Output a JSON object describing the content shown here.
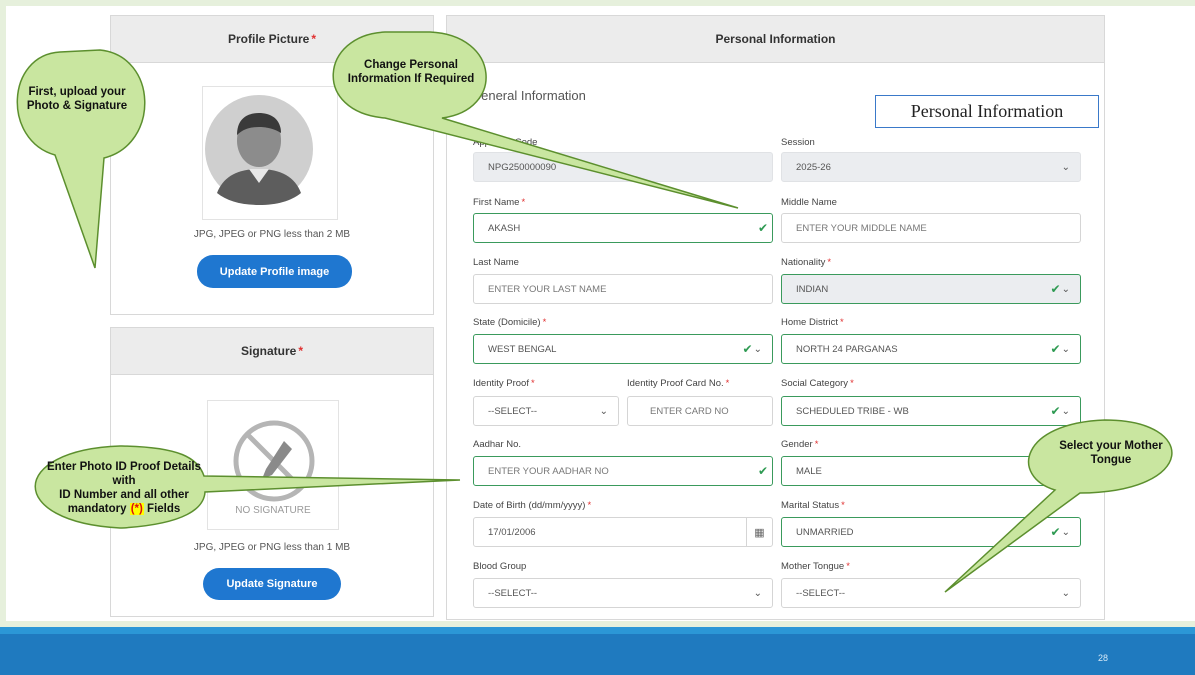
{
  "profile": {
    "title": "Profile Picture",
    "required_mark": "*",
    "hint": "JPG, JPEG or PNG less than 2 MB",
    "button": "Update Profile image"
  },
  "signature": {
    "title": "Signature",
    "required_mark": "*",
    "placeholder_text": "NO SIGNATURE",
    "hint": "JPG, JPEG or PNG less than 1 MB",
    "button": "Update Signature"
  },
  "form": {
    "title": "Personal Information",
    "section": "General Information",
    "overlay_label": "Personal Information",
    "fields": {
      "applicant_code": {
        "label": "Applicant Code",
        "value": "NPG250000090"
      },
      "session": {
        "label": "Session",
        "value": "2025-26"
      },
      "first_name": {
        "label": "First Name",
        "req": "*",
        "value": "AKASH"
      },
      "middle_name": {
        "label": "Middle Name",
        "placeholder": "ENTER YOUR MIDDLE NAME"
      },
      "last_name": {
        "label": "Last Name",
        "placeholder": "ENTER YOUR LAST NAME"
      },
      "nationality": {
        "label": "Nationality",
        "req": "*",
        "value": "INDIAN"
      },
      "state": {
        "label": "State (Domicile)",
        "req": "*",
        "value": "WEST BENGAL"
      },
      "home_district": {
        "label": "Home District",
        "req": "*",
        "value": "NORTH 24 PARGANAS"
      },
      "identity_proof": {
        "label": "Identity Proof",
        "req": "*",
        "value": "--SELECT--"
      },
      "identity_card_no": {
        "label": "Identity Proof Card No.",
        "req": "*",
        "placeholder": "ENTER CARD NO"
      },
      "social_category": {
        "label": "Social Category",
        "req": "*",
        "value": "SCHEDULED TRIBE - WB"
      },
      "aadhar": {
        "label": "Aadhar No.",
        "placeholder": "ENTER YOUR AADHAR NO"
      },
      "gender": {
        "label": "Gender",
        "req": "*",
        "value": "MALE"
      },
      "dob": {
        "label": "Date of Birth (dd/mm/yyyy)",
        "req": "*",
        "value": "17/01/2006"
      },
      "marital_status": {
        "label": "Marital Status",
        "req": "*",
        "value": "UNMARRIED"
      },
      "blood_group": {
        "label": "Blood Group",
        "value": "--SELECT--"
      },
      "mother_tongue": {
        "label": "Mother Tongue",
        "req": "*",
        "value": "--SELECT--"
      }
    }
  },
  "callouts": {
    "upload": "First, upload your Photo & Signature",
    "change": "Change Personal Information If Required",
    "photo_id_line1": "Enter Photo ID Proof Details with",
    "photo_id_line2": "ID Number and all other",
    "photo_id_line3_pre": "mandatory",
    "photo_id_line3_mark": "(*)",
    "photo_id_line3_post": "Fields",
    "mother_tongue": "Select your Mother Tongue"
  },
  "footer": {
    "page_number": "28"
  },
  "colors": {
    "accent_blue": "#1f77d0",
    "valid_green": "#3a9a5c",
    "required_red": "#e03030",
    "callout_green": "#c9e6a0"
  }
}
